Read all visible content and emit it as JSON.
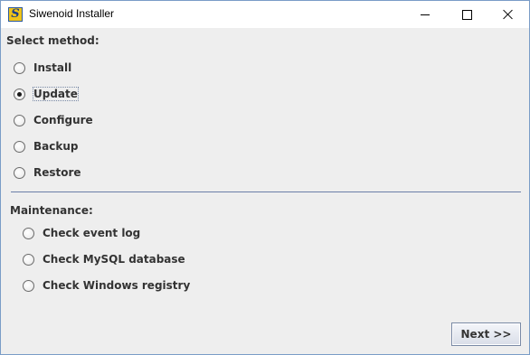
{
  "window": {
    "title": "Siwenoid Installer",
    "icon_letter": "S",
    "controls": [
      "minimize-icon",
      "maximize-icon",
      "close-icon"
    ]
  },
  "method_section": {
    "heading": "Select method:",
    "options": [
      {
        "label": "Install",
        "checked": false
      },
      {
        "label": "Update",
        "checked": true
      },
      {
        "label": "Configure",
        "checked": false
      },
      {
        "label": "Backup",
        "checked": false
      },
      {
        "label": "Restore",
        "checked": false
      }
    ]
  },
  "maintenance_section": {
    "heading": "Maintenance:",
    "options": [
      {
        "label": "Check event log",
        "checked": false
      },
      {
        "label": "Check MySQL database",
        "checked": false
      },
      {
        "label": "Check Windows registry",
        "checked": false
      }
    ]
  },
  "footer": {
    "next_label": "Next >>"
  },
  "colors": {
    "title_bar": "#ffffff",
    "window_bg": "#eeeeee",
    "separator": "#6b7fa8",
    "icon_bg": "#f0c419"
  }
}
